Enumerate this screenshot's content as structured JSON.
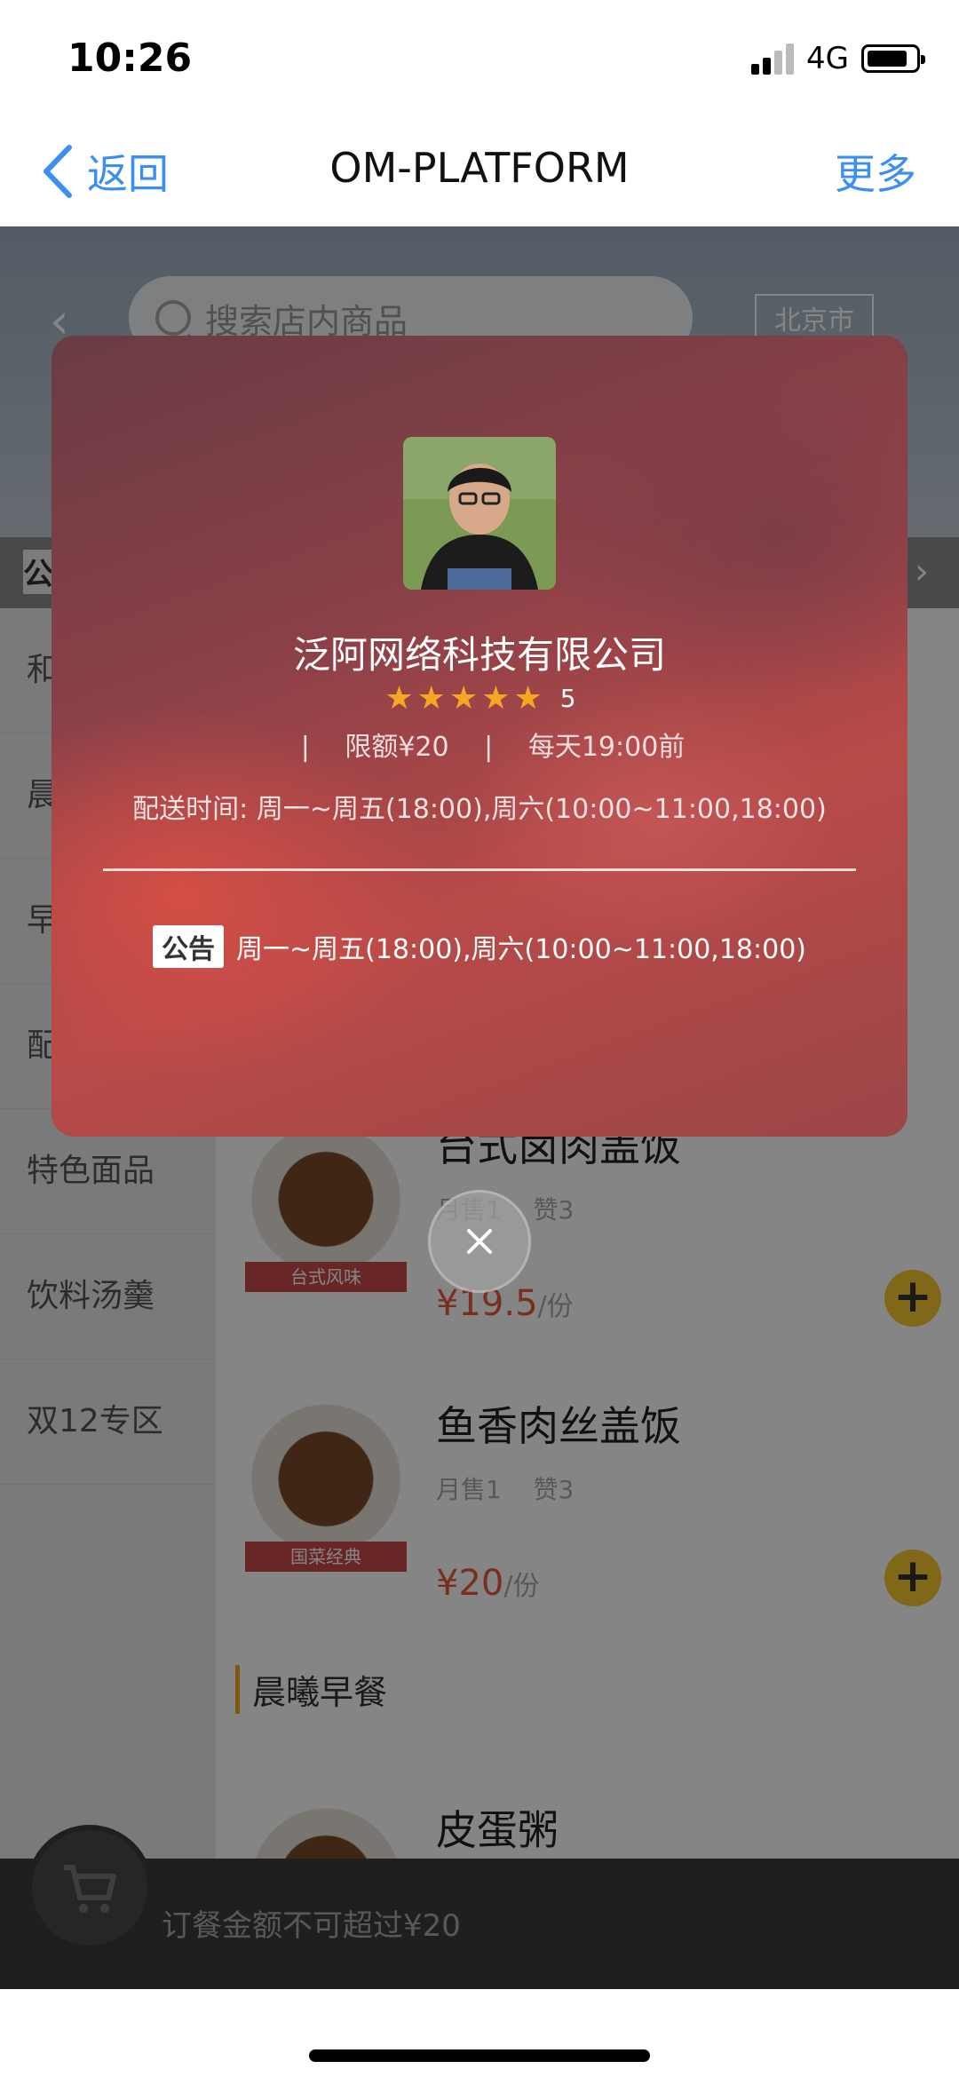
{
  "status_bar": {
    "time": "10:26",
    "network": "4G"
  },
  "nav": {
    "back_label": "返回",
    "title": "OM-PLATFORM",
    "more_label": "更多"
  },
  "store_header": {
    "search_placeholder": "搜索店内商品",
    "city": "北京市",
    "notice_tag": "公"
  },
  "categories": [
    "和",
    "晨",
    "早",
    "配菜小食",
    "特色面品",
    "饮料汤羹",
    "双12专区"
  ],
  "goods": [
    {
      "name": "台式卤肉盖饭",
      "sales": "月售1",
      "likes": "赞3",
      "price": "¥19.5",
      "unit": "/份",
      "ribbon": "台式风味"
    },
    {
      "name": "鱼香肉丝盖饭",
      "sales": "月售1",
      "likes": "赞3",
      "price": "¥20",
      "unit": "/份",
      "ribbon": "国菜经典"
    },
    {
      "name": "皮蛋粥"
    }
  ],
  "section_title": "晨曦早餐",
  "cart": {
    "message": "订餐金额不可超过¥20"
  },
  "popup": {
    "shop_name": "泛阿网络科技有限公司",
    "rating": 5,
    "rating_text": "5",
    "sep": "|",
    "limit": "限额¥20",
    "deadline": "每天19:00前",
    "delivery_time": "配送时间: 周一~周五(18:00),周六(10:00~11:00,18:00)",
    "announcement_tag": "公告",
    "announcement": "周一~周五(18:00),周六(10:00~11:00,18:00)"
  },
  "colors": {
    "accent_blue": "#3b8ff0",
    "star": "#f5a623",
    "price": "#e85a3c",
    "add_button": "#f7c52e"
  }
}
